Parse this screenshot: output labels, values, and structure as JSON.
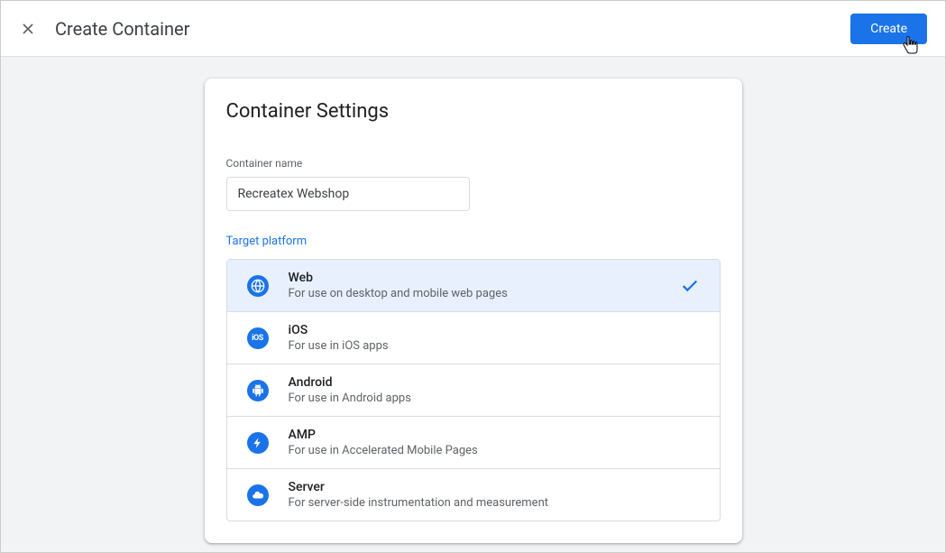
{
  "header": {
    "title": "Create Container",
    "create_button": "Create"
  },
  "card": {
    "title": "Container Settings",
    "name_label": "Container name",
    "name_value": "Recreatex Webshop",
    "platform_label": "Target platform"
  },
  "platforms": [
    {
      "name": "Web",
      "desc": "For use on desktop and mobile web pages",
      "selected": true
    },
    {
      "name": "iOS",
      "desc": "For use in iOS apps",
      "selected": false
    },
    {
      "name": "Android",
      "desc": "For use in Android apps",
      "selected": false
    },
    {
      "name": "AMP",
      "desc": "For use in Accelerated Mobile Pages",
      "selected": false
    },
    {
      "name": "Server",
      "desc": "For server-side instrumentation and measurement",
      "selected": false
    }
  ]
}
